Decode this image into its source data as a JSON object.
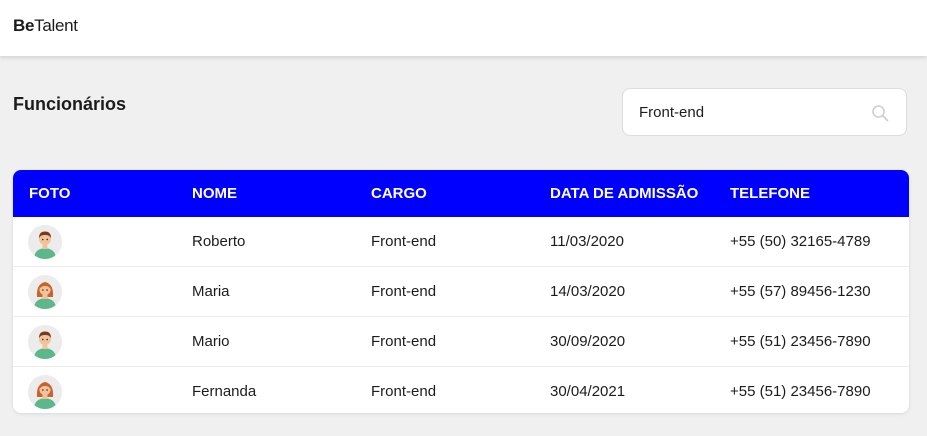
{
  "app": {
    "logo_bold": "Be",
    "logo_rest": "Talent"
  },
  "page": {
    "title": "Funcionários"
  },
  "search": {
    "value": "Front-end",
    "icon": "search-icon"
  },
  "table": {
    "columns": [
      "FOTO",
      "NOME",
      "CARGO",
      "DATA DE ADMISSÃO",
      "TELEFONE"
    ],
    "rows": [
      {
        "avatar": "male-avatar-icon",
        "name": "Roberto",
        "role": "Front-end",
        "admission": "11/03/2020",
        "phone": "+55 (50) 32165-4789"
      },
      {
        "avatar": "female-avatar-icon",
        "name": "Maria",
        "role": "Front-end",
        "admission": "14/03/2020",
        "phone": "+55 (57) 89456-1230"
      },
      {
        "avatar": "male-avatar-icon",
        "name": "Mario",
        "role": "Front-end",
        "admission": "30/09/2020",
        "phone": "+55 (51) 23456-7890"
      },
      {
        "avatar": "female-avatar-icon",
        "name": "Fernanda",
        "role": "Front-end",
        "admission": "30/04/2021",
        "phone": "+55 (51) 23456-7890"
      }
    ]
  },
  "colors": {
    "header_blue": "#0000ff",
    "background": "#f0f0f0"
  }
}
